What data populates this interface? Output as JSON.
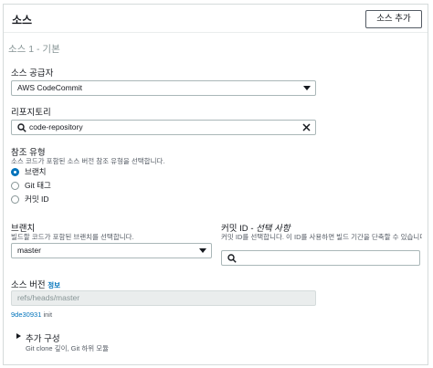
{
  "panel": {
    "title": "소스",
    "add_source_button": "소스 추가",
    "section_title": "소스 1 - 기본"
  },
  "provider": {
    "label": "소스 공급자",
    "value": "AWS CodeCommit"
  },
  "repository": {
    "label": "리포지토리",
    "value": "code-repository"
  },
  "reference_type": {
    "label": "참조 유형",
    "description": "소스 코드가 포함된 소스 버전 참조 유형을 선택합니다.",
    "options": [
      {
        "label": "브랜치",
        "selected": true
      },
      {
        "label": "Git 태그",
        "selected": false
      },
      {
        "label": "커밋 ID",
        "selected": false
      }
    ]
  },
  "branch": {
    "label": "브랜치",
    "description": "빌드할 코드가 포함된 브랜치를 선택합니다.",
    "value": "master"
  },
  "commit_id": {
    "label": "커밋 ID",
    "optional": " - 선택 사항",
    "description": "커밋 ID를 선택합니다. 이 ID를 사용하면 빌드 기간을 단축할 수 있습니다.",
    "value": ""
  },
  "source_version": {
    "label": "소스 버전",
    "info_link": "정보",
    "value": "refs/heads/master",
    "commit_hash": "9de30931",
    "commit_message": "init"
  },
  "additional_config": {
    "title": "추가 구성",
    "subtitle": "Git clone 깊이, Git 하위 모듈"
  },
  "colors": {
    "accent": "#0073bb",
    "border": "#aab7b8",
    "muted_text": "#545b64"
  }
}
